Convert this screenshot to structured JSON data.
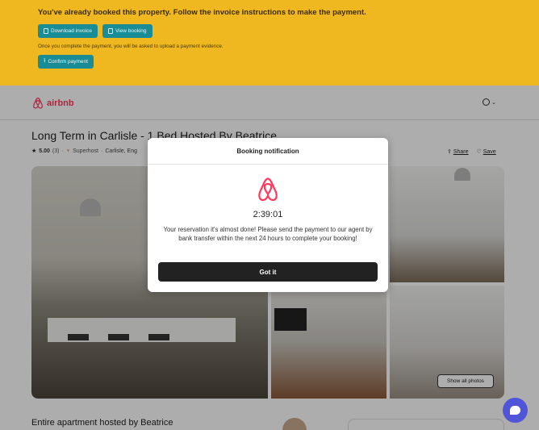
{
  "banner": {
    "message": "You've already booked this property. Follow the invoice instructions to make the payment.",
    "download_invoice": "Download invoice",
    "view_booking": "View booking",
    "note": "Once you complete the payment, you will be asked to upload a payment evidence.",
    "confirm_payment": "Confirm payment"
  },
  "header": {
    "brand": "airbnb",
    "currency_chevron": "⌄"
  },
  "listing": {
    "title": "Long Term in Carlisle - 1 Bed Hosted By Beatrice",
    "rating": "5.00",
    "reviews": "(3)",
    "superhost": "Superhost",
    "location": "Carlisle, Eng",
    "share": "Share",
    "save": "Save",
    "show_all_photos": "Show all photos",
    "host_heading": "Entire apartment hosted by Beatrice"
  },
  "modal": {
    "title": "Booking notification",
    "timer": "2:39:01",
    "message": "Your reservation it's almost done! Please send the payment to our agent by bank transfer within the next 24 hours to complete your booking!",
    "button": "Got it"
  },
  "colors": {
    "banner": "#f0b820",
    "teal_button": "#1a8c96",
    "brand": "#ff385c",
    "chat": "#4f54d8"
  },
  "icons": [
    "invoice-icon",
    "calendar-icon",
    "upload-icon",
    "airbnb-logo-icon",
    "globe-icon",
    "star-icon",
    "superhost-icon",
    "share-icon",
    "heart-icon",
    "chat-icon"
  ]
}
